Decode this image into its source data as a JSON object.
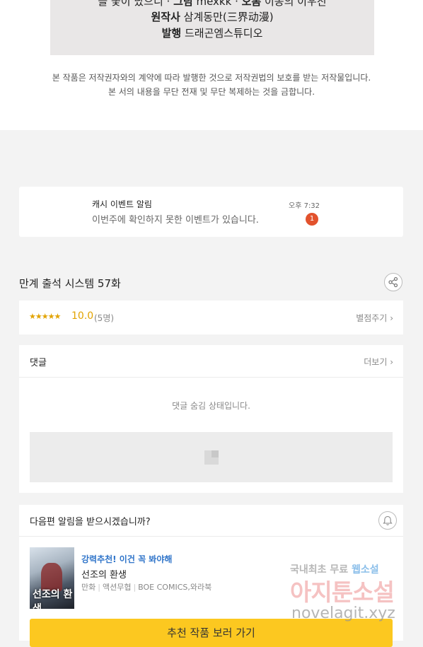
{
  "credits": {
    "line1": {
      "pre": "을 꽃이 났으니 · ",
      "art_label": "그림",
      "art_value": "mexkk · ",
      "adapt_label": "오롬",
      "adapt_value": "이동의 이우진"
    },
    "line2": {
      "label": "원작사",
      "value": "삼계동만(三界动漫)"
    },
    "line3": {
      "label": "발행",
      "value": "드래곤엠스튜디오"
    }
  },
  "copyright": {
    "line1": "본 작품은 저작권자와의 계약에 따라 발행한 것으로 저작권법의 보호를 받는 저작물입니다.",
    "line2": "본 서의 내용을 무단 전재 및 무단 복제하는 것을 금합니다."
  },
  "cash_notice": {
    "title": "캐시 이벤트 알림",
    "message": "이번주에 확인하지 못한 이벤트가 있습니다.",
    "time": "오후 7:32",
    "badge": "1"
  },
  "episode": {
    "title": "만계 출석 시스템 57화",
    "share_icon": "share-icon"
  },
  "rating": {
    "stars": "★★★★★",
    "star_fraction": 1.0,
    "score": "10.0",
    "votes": "(5명)",
    "rate_label": "별점주기",
    "rate_chevron": "›"
  },
  "comments": {
    "label": "댓글",
    "more_label": "더보기",
    "more_chevron": "›",
    "hidden_message": "댓글 숨김 상태입니다."
  },
  "notify": {
    "question": "다음편 알림을 받으시겠습니까?",
    "bell_icon": "bell-icon"
  },
  "recommendation": {
    "promo": "강력추천! 이건 꼭 봐야해",
    "title": "선조의 환생",
    "genre1": "만화",
    "genre2": "액션무협",
    "publisher": "BOE COMICS,와라북",
    "cover_text": "선조의 환생",
    "cta": "추천 작품 보러 가기"
  },
  "watermark": {
    "top_a": "국내최초 무료 ",
    "top_b": "웹소설",
    "main": "아지툰소설",
    "url": "novelagit.xyz"
  },
  "colors": {
    "accent_yellow": "#fcc820",
    "star_gold": "#e2a300",
    "badge_red": "#e2522d",
    "promo_blue": "#2f74c9"
  }
}
